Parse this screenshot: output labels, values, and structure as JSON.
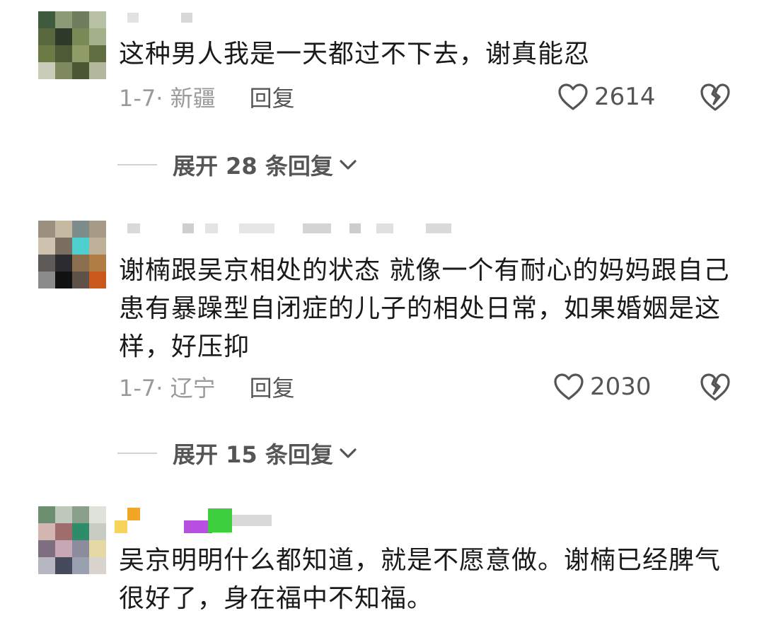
{
  "comments": [
    {
      "text": "这种男人我是一天都过不下去，谢真能忍",
      "date_loc": "1-7· 新疆",
      "reply_label": "回复",
      "likes": "2614",
      "expand_label": "展开 28 条回复"
    },
    {
      "text": "谢楠跟吴京相处的状态 就像一个有耐心的妈妈跟自己患有暴躁型自闭症的儿子的相处日常，如果婚姻是这样，好压抑",
      "date_loc": "1-7· 辽宁",
      "reply_label": "回复",
      "likes": "2030",
      "expand_label": "展开 15 条回复"
    },
    {
      "text": "吴京明明什么都知道，就是不愿意做。谢楠已经脾气很好了，身在福中不知福。"
    }
  ],
  "icons": {
    "like": "heart-outline-icon",
    "dislike": "broken-heart-icon",
    "expand": "chevron-down-icon"
  },
  "colors": {
    "text": "#1a1a1a",
    "meta": "#9a9a9a",
    "action": "#555555"
  }
}
